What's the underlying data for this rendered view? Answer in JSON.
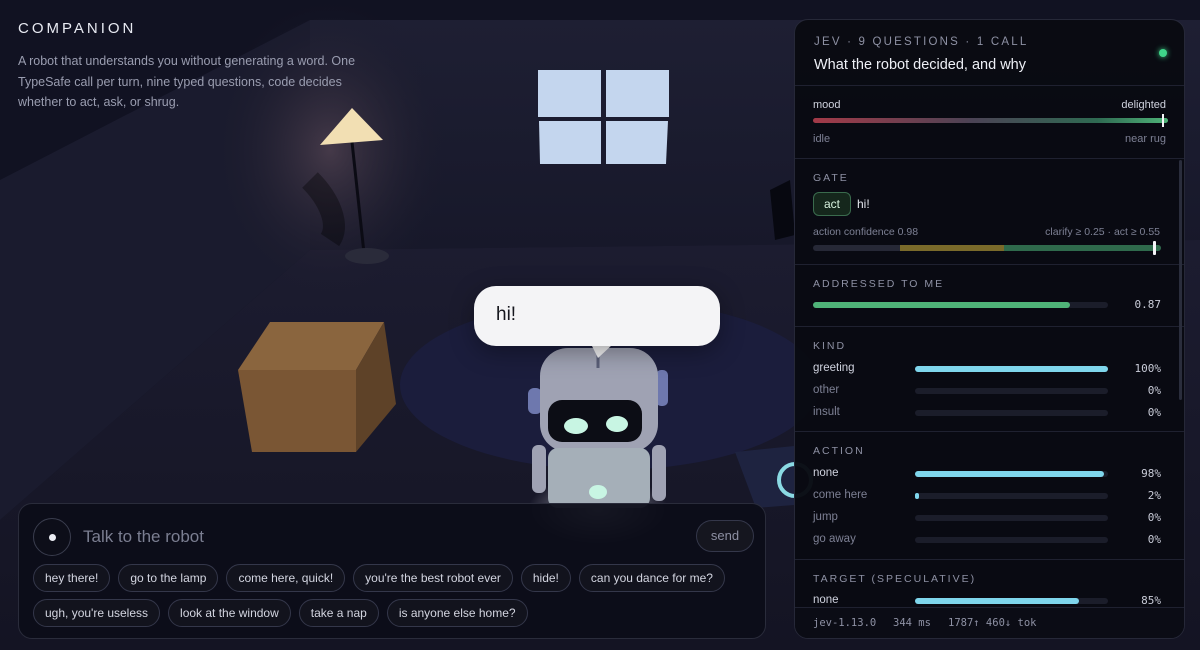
{
  "app": {
    "title": "COMPANION",
    "tagline": "A robot that understands you without generating a word. One TypeSafe call per turn, nine typed questions, code decides whether to act, ask, or shrug."
  },
  "bubble": {
    "text": "hi!"
  },
  "chat": {
    "placeholder": "Talk to the robot",
    "value": "",
    "send_label": "send",
    "suggestions": [
      [
        "hey there!",
        "go to the lamp",
        "come here, quick!",
        "you're the best robot ever",
        "hide!",
        "can you dance for me?"
      ],
      [
        "ugh, you're useless",
        "look at the window",
        "take a nap",
        "is anyone else home?"
      ]
    ]
  },
  "panel": {
    "meta": "JEV · 9 QUESTIONS · 1 CALL",
    "title": "What the robot decided, and why",
    "mood": {
      "label": "mood",
      "value": "delighted",
      "level": 0.99,
      "state": "idle",
      "location": "near rug"
    },
    "gate": {
      "title": "GATE",
      "decision": "act",
      "utterance": "hi!",
      "confidence_label": "action confidence 0.98",
      "confidence": 0.98,
      "thresholds_label": "clarify ≥ 0.25 · act ≥ 0.55",
      "clarify_threshold": 0.25,
      "act_threshold": 0.55
    },
    "addressed": {
      "title": "ADDRESSED TO ME",
      "value": 0.87,
      "value_label": "0.87"
    },
    "kind": {
      "title": "KIND",
      "items": [
        {
          "label": "greeting",
          "value": 1.0,
          "pct": "100%"
        },
        {
          "label": "other",
          "value": 0.0,
          "pct": "0%"
        },
        {
          "label": "insult",
          "value": 0.0,
          "pct": "0%"
        }
      ]
    },
    "action": {
      "title": "ACTION",
      "items": [
        {
          "label": "none",
          "value": 0.98,
          "pct": "98%"
        },
        {
          "label": "come here",
          "value": 0.02,
          "pct": "2%"
        },
        {
          "label": "jump",
          "value": 0.0,
          "pct": "0%"
        },
        {
          "label": "go away",
          "value": 0.0,
          "pct": "0%"
        }
      ]
    },
    "target": {
      "title": "TARGET (SPECULATIVE)",
      "items": [
        {
          "label": "none",
          "value": 0.85,
          "pct": "85%"
        }
      ]
    },
    "footer": {
      "version": "jev-1.13.0",
      "latency": "344 ms",
      "tokens": "1787↑ 460↓ tok"
    }
  },
  "colors": {
    "background": "#0f1020",
    "accent_cyan": "#7fd6ec",
    "accent_green": "#4fb378",
    "status_green": "#3fd68a",
    "mood_red": "#a33a48"
  }
}
